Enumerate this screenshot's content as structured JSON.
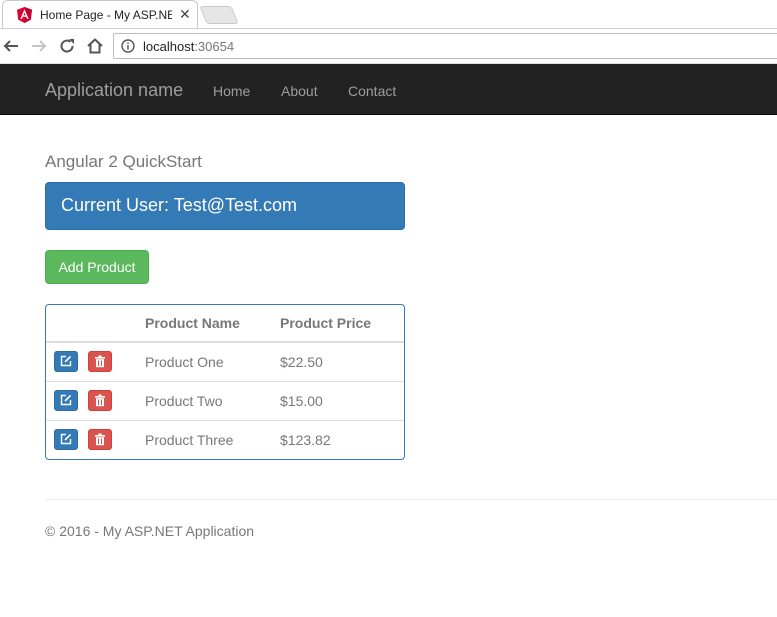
{
  "browser": {
    "tab_title": "Home Page - My ASP.NE",
    "url_host": "localhost",
    "url_port": ":30654"
  },
  "navbar": {
    "brand": "Application name",
    "links": [
      "Home",
      "About",
      "Contact"
    ]
  },
  "main": {
    "heading": "Angular 2 QuickStart",
    "current_user": "Current User: Test@Test.com",
    "add_button_label": "Add Product",
    "table": {
      "headers": [
        "",
        "Product Name",
        "Product Price"
      ],
      "rows": [
        {
          "name": "Product One",
          "price": "$22.50"
        },
        {
          "name": "Product Two",
          "price": "$15.00"
        },
        {
          "name": "Product Three",
          "price": "$123.82"
        }
      ]
    }
  },
  "footer": {
    "text": "© 2016 - My ASP.NET Application"
  },
  "colors": {
    "navbar": "#222222",
    "primary": "#337ab7",
    "success": "#5cb85c",
    "danger": "#d9534f"
  },
  "icons": {
    "edit": "edit-icon",
    "delete": "trash-icon"
  }
}
